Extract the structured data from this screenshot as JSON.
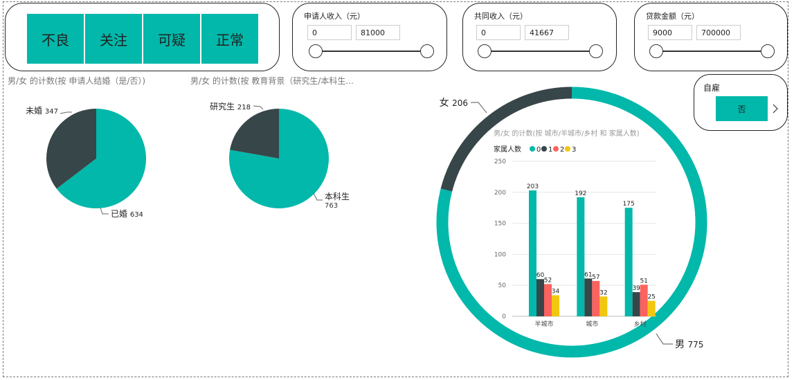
{
  "filters": {
    "category_buttons": [
      "不良",
      "关注",
      "可疑",
      "正常"
    ],
    "applicant_income": {
      "title": "申请人收入（元）",
      "min": "0",
      "max": "81000"
    },
    "joint_income": {
      "title": "共同收入（元）",
      "min": "0",
      "max": "41667"
    },
    "loan_amount": {
      "title": "贷款金额（元）",
      "min": "9000",
      "max": "700000"
    },
    "self_employed": {
      "title": "自雇",
      "value": "否"
    }
  },
  "colors": {
    "teal": "#01b8aa",
    "dark": "#374649",
    "red": "#fd625e",
    "yellow": "#f2c80f"
  },
  "chart_data": [
    {
      "type": "pie",
      "title": "男/女 的计数(按 申请人结婚（是/否）)",
      "slices": [
        {
          "label": "已婚",
          "value": 634
        },
        {
          "label": "未婚",
          "value": 347
        }
      ]
    },
    {
      "type": "pie",
      "title": "男/女 的计数(按 教育背景（研究生/本科生...",
      "slices": [
        {
          "label": "本科生",
          "value": 763
        },
        {
          "label": "研究生",
          "value": 218
        }
      ]
    },
    {
      "type": "pie",
      "title": "",
      "slices": [
        {
          "label": "男",
          "value": 775
        },
        {
          "label": "女",
          "value": 206
        }
      ]
    },
    {
      "type": "bar",
      "title": "男/女 的计数(按 城市/半城市/乡村 和 家属人数)",
      "legend_title": "家属人数",
      "legend_position": "top-left",
      "categories": [
        "半城市",
        "城市",
        "乡村"
      ],
      "series": [
        {
          "name": "0",
          "values": [
            203,
            192,
            175
          ]
        },
        {
          "name": "1",
          "values": [
            60,
            61,
            39
          ]
        },
        {
          "name": "2",
          "values": [
            52,
            57,
            51
          ]
        },
        {
          "name": "3",
          "values": [
            34,
            32,
            25
          ]
        }
      ],
      "yticks": [
        "0",
        "50",
        "100",
        "150",
        "200",
        "250"
      ],
      "ylim": [
        0,
        250
      ],
      "grid": true
    }
  ]
}
